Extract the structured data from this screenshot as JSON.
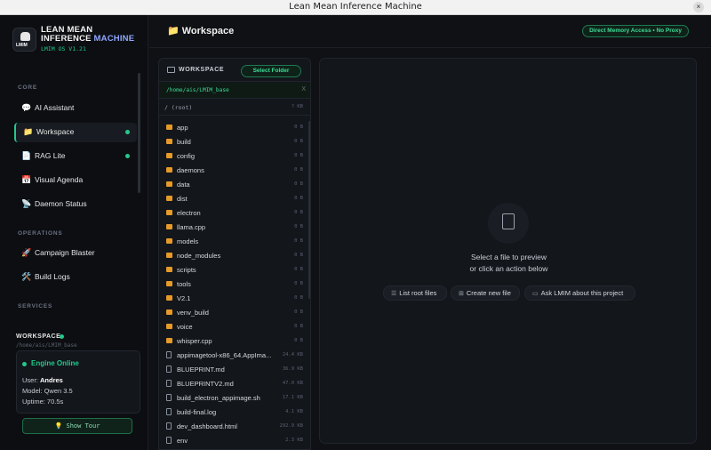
{
  "window": {
    "title": "Lean Mean Inference Machine",
    "close_glyph": "×"
  },
  "brand": {
    "name_line1": "LEAN MEAN",
    "name_line2a": "INFERENCE ",
    "name_line2b": "MACHINE",
    "version": "LMIM OS V1.21",
    "logo_text": "LMIM"
  },
  "sidebar": {
    "sections": {
      "core": "CORE",
      "operations": "OPERATIONS",
      "services": "SERVICES"
    },
    "items": [
      {
        "label": "AI Assistant",
        "icon": "💬"
      },
      {
        "label": "Workspace",
        "icon": "📁"
      },
      {
        "label": "RAG Lite",
        "icon": "📄"
      },
      {
        "label": "Visual Agenda",
        "icon": "📅"
      },
      {
        "label": "Daemon Status",
        "icon": "📡"
      },
      {
        "label": "Campaign Blaster",
        "icon": "🚀"
      },
      {
        "label": "Build Logs",
        "icon": "🛠️"
      }
    ],
    "workspace_label": "WORKSPACE",
    "workspace_path": "/home/ais/LMIM_base",
    "engine": {
      "status": "Engine Online",
      "user_label": "User: ",
      "user": "Andres",
      "model": "Model: Qwen 3.5",
      "uptime": "Uptime: 70.5s"
    },
    "tour_button": "💡 Show Tour"
  },
  "header": {
    "title": "📁 Workspace",
    "badge": "Direct Memory Access • No Proxy"
  },
  "explorer": {
    "title": "WORKSPACE",
    "select_folder": "Select Folder",
    "path": "/home/ais/LMIM_base",
    "clear_glyph": "X",
    "root_label": "/ (root)",
    "root_hint": "? KB",
    "files": [
      {
        "name": "app",
        "size": "0 B",
        "type": "folder"
      },
      {
        "name": "build",
        "size": "0 B",
        "type": "folder"
      },
      {
        "name": "config",
        "size": "0 B",
        "type": "folder"
      },
      {
        "name": "daemons",
        "size": "0 B",
        "type": "folder"
      },
      {
        "name": "data",
        "size": "0 B",
        "type": "folder"
      },
      {
        "name": "dist",
        "size": "0 B",
        "type": "folder"
      },
      {
        "name": "electron",
        "size": "0 B",
        "type": "folder"
      },
      {
        "name": "llama.cpp",
        "size": "0 B",
        "type": "folder"
      },
      {
        "name": "models",
        "size": "0 B",
        "type": "folder"
      },
      {
        "name": "node_modules",
        "size": "0 B",
        "type": "folder"
      },
      {
        "name": "scripts",
        "size": "0 B",
        "type": "folder"
      },
      {
        "name": "tools",
        "size": "0 B",
        "type": "folder"
      },
      {
        "name": "V2.1",
        "size": "0 B",
        "type": "folder"
      },
      {
        "name": "venv_build",
        "size": "0 B",
        "type": "folder"
      },
      {
        "name": "voice",
        "size": "0 B",
        "type": "folder"
      },
      {
        "name": "whisper.cpp",
        "size": "0 B",
        "type": "folder"
      },
      {
        "name": "appimagetool-x86_64.AppIma...",
        "size": "24.4 KB",
        "type": "file"
      },
      {
        "name": "BLUEPRINT.md",
        "size": "36.9 KB",
        "type": "file"
      },
      {
        "name": "BLUEPRINTV2.md",
        "size": "47.0 KB",
        "type": "file"
      },
      {
        "name": "build_electron_appimage.sh",
        "size": "17.1 KB",
        "type": "file"
      },
      {
        "name": "build-final.log",
        "size": "4.1 KB",
        "type": "file"
      },
      {
        "name": "dev_dashboard.html",
        "size": "292.9 KB",
        "type": "file"
      },
      {
        "name": "env",
        "size": "2.3 KB",
        "type": "file"
      }
    ]
  },
  "preview": {
    "line1": "Select a file to preview",
    "line2": "or click an action below",
    "actions": [
      {
        "label": "List root files",
        "icon": "☰"
      },
      {
        "label": "Create new file",
        "icon": "⊞"
      },
      {
        "label": "Ask LMIM about this project",
        "icon": "▭"
      }
    ]
  },
  "colors": {
    "accent": "#23c98a",
    "folder": "#e59a2a",
    "brand_accent": "#8fa6ff"
  }
}
